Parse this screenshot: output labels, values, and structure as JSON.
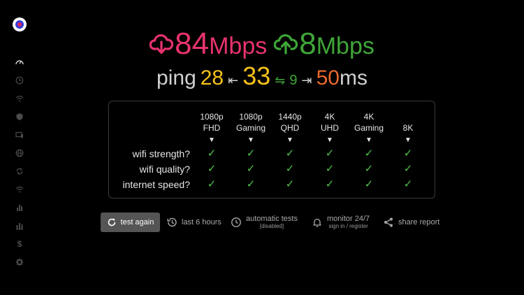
{
  "speeds": {
    "download": {
      "value": "84",
      "unit": "Mbps",
      "color": "#e8336d",
      "icon": "cloud-download-icon"
    },
    "upload": {
      "value": "8",
      "unit": "Mbps",
      "color": "#3fa638",
      "icon": "cloud-upload-icon"
    }
  },
  "ping": {
    "label": "ping",
    "min": "28",
    "avg": "33",
    "jitter": "9",
    "max": "50",
    "unit": "ms",
    "arrow_left": "⇤",
    "arrow_jitter": "⇋",
    "arrow_right": "⇥"
  },
  "quality": {
    "columns": [
      {
        "line1": "1080p",
        "line2": "FHD"
      },
      {
        "line1": "1080p",
        "line2": "Gaming"
      },
      {
        "line1": "1440p",
        "line2": "QHD"
      },
      {
        "line1": "4K",
        "line2": "UHD"
      },
      {
        "line1": "4K",
        "line2": "Gaming"
      },
      {
        "line1": "",
        "line2": "8K"
      }
    ],
    "column_marker": "▼",
    "rows": [
      {
        "label": "wifi strength?",
        "checks": [
          "✓",
          "✓",
          "✓",
          "✓",
          "✓",
          "✓"
        ]
      },
      {
        "label": "wifi quality?",
        "checks": [
          "✓",
          "✓",
          "✓",
          "✓",
          "✓",
          "✓"
        ]
      },
      {
        "label": "internet speed?",
        "checks": [
          "✓",
          "✓",
          "✓",
          "✓",
          "✓",
          "✓"
        ]
      }
    ]
  },
  "actions": {
    "test_again": "test again",
    "last_hours": "last 6 hours",
    "auto_tests": "automatic tests",
    "auto_tests_sub": "[disabled]",
    "monitor": "monitor 24/7",
    "monitor_sub": "sign in / register",
    "share": "share report"
  },
  "sidebar": {
    "items": [
      "speedometer-icon",
      "history-icon",
      "wifi-signal-icon",
      "shield-icon",
      "devices-icon",
      "globe-icon",
      "sync-icon",
      "wifi-icon",
      "bar-chart-icon",
      "stacked-chart-icon",
      "dollar-icon",
      "gear-icon"
    ]
  }
}
